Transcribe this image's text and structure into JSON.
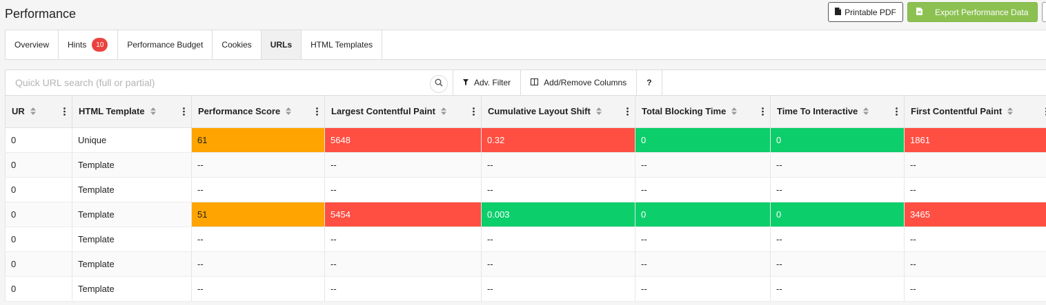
{
  "header": {
    "title": "Performance",
    "printable_pdf_label": "Printable PDF",
    "export_label": "Export Performance Data"
  },
  "tabs": [
    {
      "label": "Overview"
    },
    {
      "label": "Hints",
      "badge": "10"
    },
    {
      "label": "Performance Budget"
    },
    {
      "label": "Cookies"
    },
    {
      "label": "URLs",
      "active": true
    },
    {
      "label": "HTML Templates"
    }
  ],
  "toolbar": {
    "search_placeholder": "Quick URL search (full or partial)",
    "search_value": "",
    "adv_filter_label": "Adv. Filter",
    "columns_label": "Add/Remove Columns",
    "help_label": "?"
  },
  "table": {
    "columns": [
      "UR",
      "HTML Template",
      "Performance Score",
      "Largest Contentful Paint",
      "Cumulative Layout Shift",
      "Total Blocking Time",
      "Time To Interactive",
      "First Contentful Paint"
    ],
    "rows": [
      [
        "0",
        "Unique",
        "61",
        "5648",
        "0.32",
        "0",
        "0",
        "1861"
      ],
      [
        "0",
        "Template",
        "--",
        "--",
        "--",
        "--",
        "--",
        "--"
      ],
      [
        "0",
        "Template",
        "--",
        "--",
        "--",
        "--",
        "--",
        "--"
      ],
      [
        "0",
        "Template",
        "51",
        "5454",
        "0.003",
        "0",
        "0",
        "3465"
      ],
      [
        "0",
        "Template",
        "--",
        "--",
        "--",
        "--",
        "--",
        "--"
      ],
      [
        "0",
        "Template",
        "--",
        "--",
        "--",
        "--",
        "--",
        "--"
      ],
      [
        "0",
        "Template",
        "--",
        "--",
        "--",
        "--",
        "--",
        "--"
      ]
    ],
    "row_status": [
      [
        null,
        null,
        "orange",
        "red",
        "red",
        "green",
        "green",
        "red"
      ],
      [
        null,
        null,
        null,
        null,
        null,
        null,
        null,
        null
      ],
      [
        null,
        null,
        null,
        null,
        null,
        null,
        null,
        null
      ],
      [
        null,
        null,
        "orange",
        "red",
        "green",
        "green",
        "green",
        "red"
      ],
      [
        null,
        null,
        null,
        null,
        null,
        null,
        null,
        null
      ],
      [
        null,
        null,
        null,
        null,
        null,
        null,
        null,
        null
      ],
      [
        null,
        null,
        null,
        null,
        null,
        null,
        null,
        null
      ]
    ]
  },
  "colors": {
    "export_button": "#8cc152",
    "badge": "#e9423f",
    "score_average": "#ffa400",
    "score_poor": "#ff4e42",
    "score_good": "#0cce6b"
  },
  "icons": {
    "pdf": "file-icon",
    "export": "spreadsheet-file-icon",
    "search": "search-icon",
    "filter": "filter-icon",
    "columns": "columns-icon",
    "sort": "sort-icon",
    "menu": "kebab-menu-icon"
  }
}
